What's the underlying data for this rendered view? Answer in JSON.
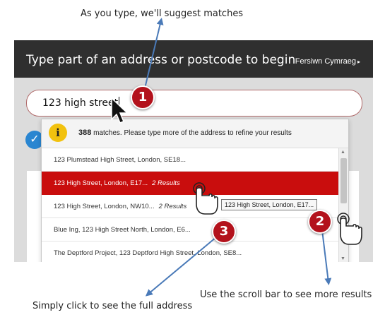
{
  "annotations": {
    "top": "As you type, we'll suggest matches",
    "bottom_left": "Simply click to see the full address",
    "bottom_right": "Use the scroll bar to see more results"
  },
  "badges": [
    "1",
    "2",
    "3"
  ],
  "header": {
    "title": "Type part of an address or postcode to begin",
    "language_link": "Fersiwn Cymraeg",
    "language_chevron": "▸"
  },
  "search": {
    "value": "123 high street"
  },
  "dropdown": {
    "info_icon": "i",
    "match_count": "388",
    "match_text": " matches. Please type more of the address to refine your results",
    "results": [
      {
        "address": "123 Plumstead High Street, London, SE18...",
        "count": ""
      },
      {
        "address": "123 High Street, London, E17...",
        "count": "2 Results"
      },
      {
        "address": "123 High Street, London, NW10...",
        "count": "2 Results"
      },
      {
        "address": "Blue Ing, 123 High Street North, London, E6...",
        "count": ""
      },
      {
        "address": "The Deptford Project, 123 Deptford High Street, London, SE8...",
        "count": ""
      }
    ],
    "selected_index": 1,
    "scroll_up": "▲",
    "scroll_down": "▼"
  },
  "tooltip": "123 High Street, London, E17...",
  "icons": {
    "check": "✓",
    "cursor": "arrow-cursor-icon",
    "hand": "hand-pointer-icon"
  },
  "colors": {
    "header_bg": "#2f2f2f",
    "selected_row": "#c90d0d",
    "badge": "#b3121c",
    "info_icon": "#f2c20f",
    "check_circle": "#2a86d1",
    "arrow": "#4a7ab8"
  }
}
